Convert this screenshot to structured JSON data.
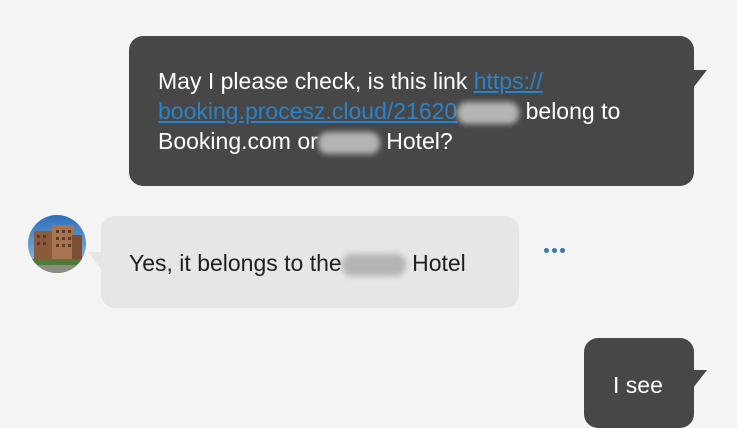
{
  "messages": {
    "outgoing_1": {
      "text_before_link": "May I please check, is this link ",
      "link_text_line1": "https://",
      "link_text_line2": "booking.procesz.cloud/21620",
      "text_after_link": " belong to",
      "text_line3_start": "Booking.com or",
      "text_line3_end": " Hotel?"
    },
    "incoming_1": {
      "text_start": "Yes, it belongs to the",
      "text_end": " Hotel"
    },
    "outgoing_2": {
      "text": "I see"
    }
  },
  "colors": {
    "outgoing_bubble": "#474747",
    "incoming_bubble": "#e6e6e6",
    "link": "#2a83c9",
    "more_dots": "#3a78b0",
    "background": "#f4f4f4"
  },
  "icons": {
    "more": "more-horizontal-icon"
  }
}
